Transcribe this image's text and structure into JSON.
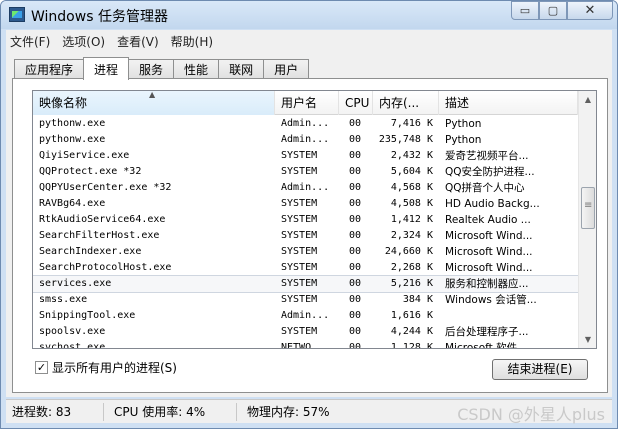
{
  "window": {
    "title": "Windows 任务管理器",
    "minimize": "▭",
    "maximize": "▢",
    "close": "✕"
  },
  "menu": [
    "文件(F)",
    "选项(O)",
    "查看(V)",
    "帮助(H)"
  ],
  "tabs": [
    {
      "label": "应用程序",
      "active": false
    },
    {
      "label": "进程",
      "active": true
    },
    {
      "label": "服务",
      "active": false
    },
    {
      "label": "性能",
      "active": false
    },
    {
      "label": "联网",
      "active": false
    },
    {
      "label": "用户",
      "active": false
    }
  ],
  "columns": {
    "image": "映像名称",
    "user": "用户名",
    "cpu": "CPU",
    "memory": "内存(...",
    "description": "描述"
  },
  "rows": [
    {
      "image": "pythonw.exe",
      "user": "Admin...",
      "cpu": "00",
      "memory": "7,416 K",
      "description": "Python"
    },
    {
      "image": "pythonw.exe",
      "user": "Admin...",
      "cpu": "00",
      "memory": "235,748 K",
      "description": "Python"
    },
    {
      "image": "QiyiService.exe",
      "user": "SYSTEM",
      "cpu": "00",
      "memory": "2,432 K",
      "description": "爱奇艺视频平台..."
    },
    {
      "image": "QQProtect.exe *32",
      "user": "SYSTEM",
      "cpu": "00",
      "memory": "5,604 K",
      "description": "QQ安全防护进程..."
    },
    {
      "image": "QQPYUserCenter.exe *32",
      "user": "Admin...",
      "cpu": "00",
      "memory": "4,568 K",
      "description": "QQ拼音个人中心"
    },
    {
      "image": "RAVBg64.exe",
      "user": "SYSTEM",
      "cpu": "00",
      "memory": "4,508 K",
      "description": "HD Audio Backg..."
    },
    {
      "image": "RtkAudioService64.exe",
      "user": "SYSTEM",
      "cpu": "00",
      "memory": "1,412 K",
      "description": "Realtek Audio ..."
    },
    {
      "image": "SearchFilterHost.exe",
      "user": "SYSTEM",
      "cpu": "00",
      "memory": "2,324 K",
      "description": "Microsoft Wind..."
    },
    {
      "image": "SearchIndexer.exe",
      "user": "SYSTEM",
      "cpu": "00",
      "memory": "24,660 K",
      "description": "Microsoft Wind..."
    },
    {
      "image": "SearchProtocolHost.exe",
      "user": "SYSTEM",
      "cpu": "00",
      "memory": "2,268 K",
      "description": "Microsoft Wind..."
    },
    {
      "image": "services.exe",
      "user": "SYSTEM",
      "cpu": "00",
      "memory": "5,216 K",
      "description": "服务和控制器应..."
    },
    {
      "image": "smss.exe",
      "user": "SYSTEM",
      "cpu": "00",
      "memory": "384 K",
      "description": "Windows 会话管..."
    },
    {
      "image": "SnippingTool.exe",
      "user": "Admin...",
      "cpu": "00",
      "memory": "1,616 K",
      "description": ""
    },
    {
      "image": "spoolsv.exe",
      "user": "SYSTEM",
      "cpu": "00",
      "memory": "4,244 K",
      "description": "后台处理程序子..."
    },
    {
      "image": "svchost.exe",
      "user": "NETWO...",
      "cpu": "00",
      "memory": "1,128 K",
      "description": "Microsoft 软件..."
    }
  ],
  "show_all_users": {
    "label": "显示所有用户的进程(S)",
    "checked": true
  },
  "end_process_button": "结束进程(E)",
  "status": {
    "processes": "进程数: 83",
    "cpu": "CPU 使用率: 4%",
    "memory": "物理内存: 57%"
  },
  "watermark": "CSDN @外星人plus"
}
